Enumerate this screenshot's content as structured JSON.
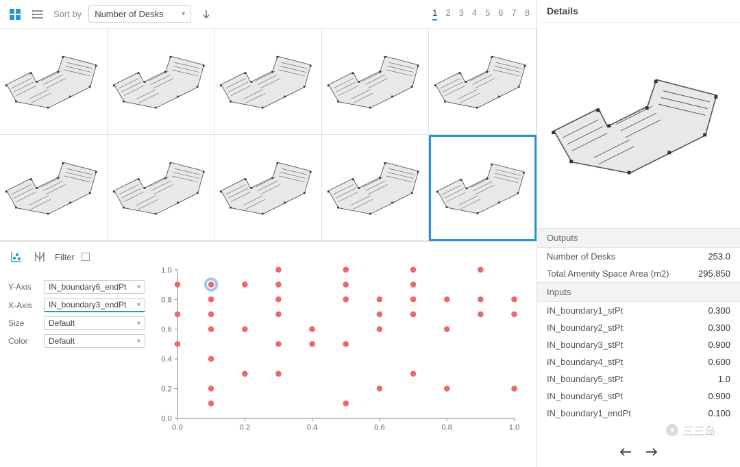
{
  "toolbar": {
    "sort_label": "Sort by",
    "sort_value": "Number of Desks",
    "pages": [
      "1",
      "2",
      "3",
      "4",
      "5",
      "6",
      "7",
      "8"
    ],
    "current_page": 0
  },
  "grid": {
    "cells": 10,
    "selected_index": 9
  },
  "chart_toolbar": {
    "filter_label": "Filter"
  },
  "axis_controls": {
    "yaxis_label": "Y-Axis",
    "yaxis_value": "IN_boundary6_endPt",
    "xaxis_label": "X-Axis",
    "xaxis_value": "IN_boundary3_endPt",
    "size_label": "Size",
    "size_value": "Default",
    "color_label": "Color",
    "color_value": "Default"
  },
  "chart_data": {
    "type": "scatter",
    "xlabel": "",
    "ylabel": "",
    "xlim": [
      0.0,
      1.0
    ],
    "ylim": [
      0.0,
      1.0
    ],
    "x_ticks": [
      "0.0",
      "0.2",
      "0.4",
      "0.6",
      "0.8",
      "1.0"
    ],
    "y_ticks": [
      "0.0",
      "0.2",
      "0.4",
      "0.6",
      "0.8",
      "1.0"
    ],
    "points": [
      {
        "x": 0.0,
        "y": 0.5
      },
      {
        "x": 0.0,
        "y": 0.7
      },
      {
        "x": 0.0,
        "y": 0.9
      },
      {
        "x": 0.1,
        "y": 0.1
      },
      {
        "x": 0.1,
        "y": 0.2
      },
      {
        "x": 0.1,
        "y": 0.4
      },
      {
        "x": 0.1,
        "y": 0.6
      },
      {
        "x": 0.1,
        "y": 0.7
      },
      {
        "x": 0.1,
        "y": 0.8
      },
      {
        "x": 0.1,
        "y": 0.9,
        "selected": true
      },
      {
        "x": 0.2,
        "y": 0.3
      },
      {
        "x": 0.2,
        "y": 0.6
      },
      {
        "x": 0.2,
        "y": 0.9
      },
      {
        "x": 0.3,
        "y": 0.3
      },
      {
        "x": 0.3,
        "y": 0.5
      },
      {
        "x": 0.3,
        "y": 0.7
      },
      {
        "x": 0.3,
        "y": 0.8
      },
      {
        "x": 0.3,
        "y": 0.9
      },
      {
        "x": 0.3,
        "y": 1.0
      },
      {
        "x": 0.4,
        "y": 0.5
      },
      {
        "x": 0.4,
        "y": 0.6
      },
      {
        "x": 0.5,
        "y": 0.1
      },
      {
        "x": 0.5,
        "y": 0.5
      },
      {
        "x": 0.5,
        "y": 0.8
      },
      {
        "x": 0.5,
        "y": 0.9
      },
      {
        "x": 0.5,
        "y": 1.0
      },
      {
        "x": 0.6,
        "y": 0.2
      },
      {
        "x": 0.6,
        "y": 0.6
      },
      {
        "x": 0.6,
        "y": 0.7
      },
      {
        "x": 0.6,
        "y": 0.8
      },
      {
        "x": 0.7,
        "y": 0.3
      },
      {
        "x": 0.7,
        "y": 0.7
      },
      {
        "x": 0.7,
        "y": 0.8
      },
      {
        "x": 0.7,
        "y": 0.9
      },
      {
        "x": 0.7,
        "y": 1.0
      },
      {
        "x": 0.8,
        "y": 0.2
      },
      {
        "x": 0.8,
        "y": 0.6
      },
      {
        "x": 0.8,
        "y": 0.8
      },
      {
        "x": 0.9,
        "y": 0.7
      },
      {
        "x": 0.9,
        "y": 0.8
      },
      {
        "x": 0.9,
        "y": 1.0
      },
      {
        "x": 1.0,
        "y": 0.2
      },
      {
        "x": 1.0,
        "y": 0.7
      },
      {
        "x": 1.0,
        "y": 0.8
      }
    ]
  },
  "details": {
    "header": "Details",
    "outputs_header": "Outputs",
    "inputs_header": "Inputs",
    "outputs": [
      {
        "k": "Number of Desks",
        "v": "253.0"
      },
      {
        "k": "Total Amenity Space Area (m2)",
        "v": "295.850"
      }
    ],
    "inputs": [
      {
        "k": "IN_boundary1_stPt",
        "v": "0.300"
      },
      {
        "k": "IN_boundary2_stPt",
        "v": "0.300"
      },
      {
        "k": "IN_boundary3_stPt",
        "v": "0.900"
      },
      {
        "k": "IN_boundary4_stPt",
        "v": "0.600"
      },
      {
        "k": "IN_boundary5_stPt",
        "v": "1.0"
      },
      {
        "k": "IN_boundary6_stPt",
        "v": "0.900"
      },
      {
        "k": "IN_boundary1_endPt",
        "v": "0.100"
      }
    ]
  },
  "watermark": "三三岛"
}
